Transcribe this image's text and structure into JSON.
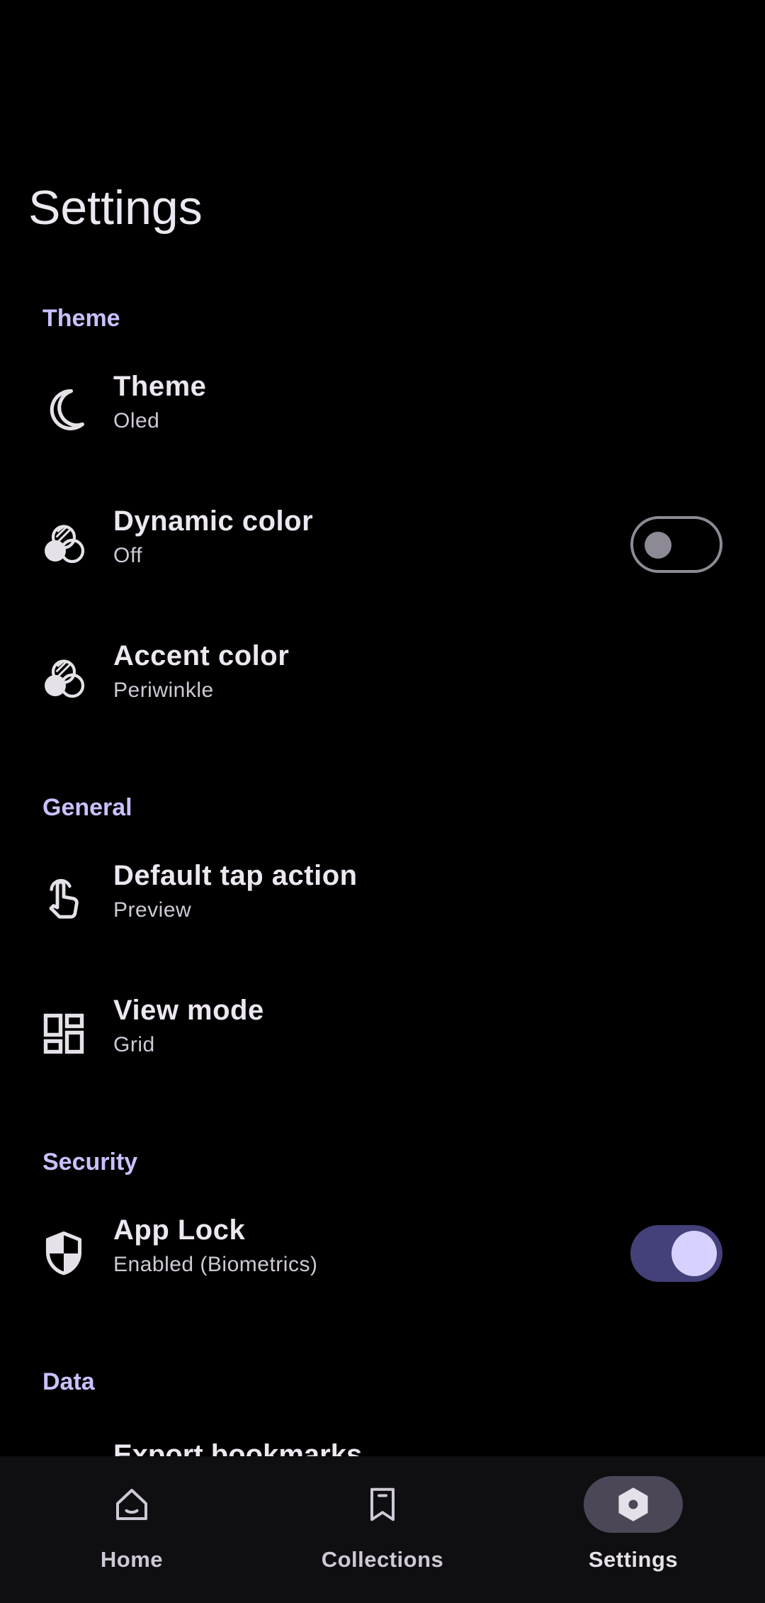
{
  "page": {
    "title": "Settings"
  },
  "colors": {
    "accent": "#c9c1ff",
    "switch_on_track": "#43407a",
    "switch_on_knob": "#d6d1ff",
    "nav_background": "#0f0e11"
  },
  "sections": {
    "theme": {
      "header": "Theme",
      "items": [
        {
          "title": "Theme",
          "subtitle": "Oled",
          "icon": "moon-icon"
        },
        {
          "title": "Dynamic color",
          "subtitle": "Off",
          "icon": "color-circles-icon",
          "toggle": false
        },
        {
          "title": "Accent color",
          "subtitle": "Periwinkle",
          "icon": "color-circles-icon"
        }
      ]
    },
    "general": {
      "header": "General",
      "items": [
        {
          "title": "Default tap action",
          "subtitle": "Preview",
          "icon": "tap-hand-icon"
        },
        {
          "title": "View mode",
          "subtitle": "Grid",
          "icon": "grid-dashboard-icon"
        }
      ]
    },
    "security": {
      "header": "Security",
      "items": [
        {
          "title": "App Lock",
          "subtitle": "Enabled (Biometrics)",
          "icon": "shield-icon",
          "toggle": true
        }
      ]
    },
    "data": {
      "header": "Data",
      "items": [
        {
          "title": "Export bookmarks"
        }
      ]
    }
  },
  "nav": {
    "items": [
      {
        "label": "Home",
        "icon": "home-smile-icon",
        "active": false
      },
      {
        "label": "Collections",
        "icon": "bookmark-icon",
        "active": false
      },
      {
        "label": "Settings",
        "icon": "settings-hexagon-icon",
        "active": true
      }
    ]
  }
}
